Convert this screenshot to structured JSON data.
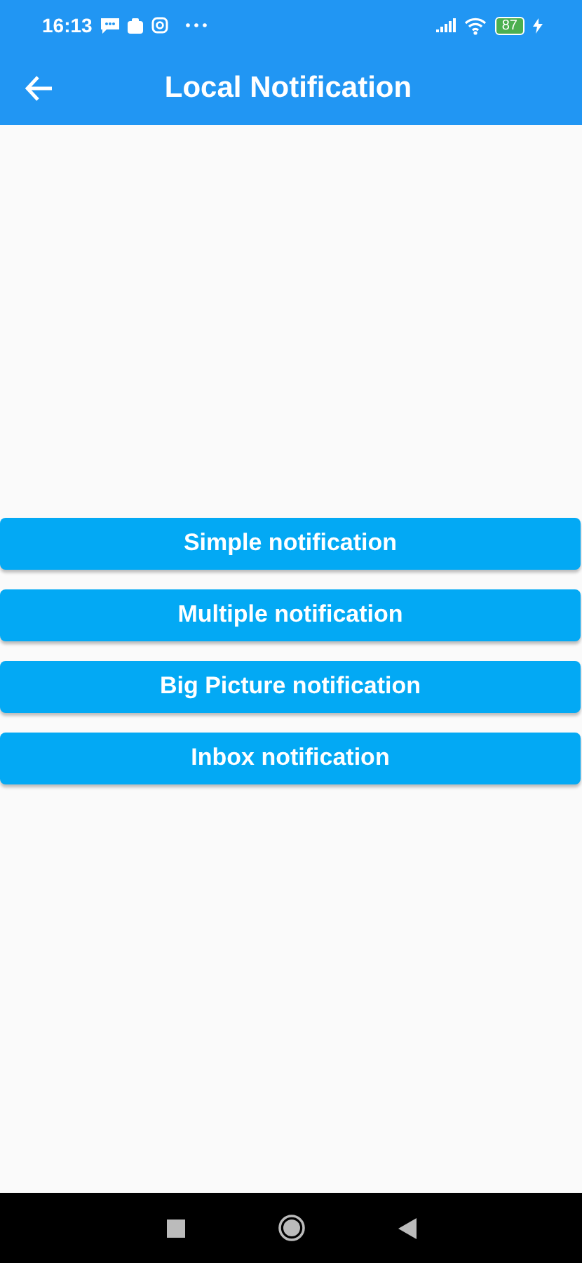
{
  "status_bar": {
    "time": "16:13",
    "battery": "87"
  },
  "app_bar": {
    "title": "Local Notification"
  },
  "buttons": [
    {
      "label": "Simple notification"
    },
    {
      "label": "Multiple notification"
    },
    {
      "label": "Big Picture notification"
    },
    {
      "label": "Inbox notification"
    }
  ]
}
